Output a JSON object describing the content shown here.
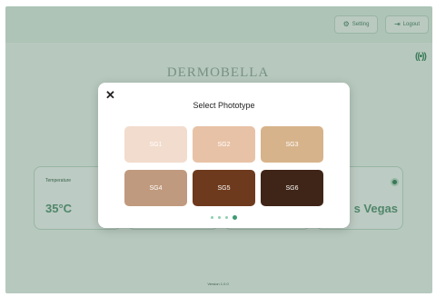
{
  "header": {
    "setting_label": "Setting",
    "logout_label": "Logout",
    "setting_icon": "gear-icon",
    "logout_icon": "logout-icon"
  },
  "status_icon": "wireless-signal-icon",
  "brand": "DERMOBELLA",
  "cards": [
    {
      "label": "Temperature",
      "value": "35°C"
    },
    {
      "label": "",
      "value": ""
    },
    {
      "label": "",
      "value": ""
    },
    {
      "label": "",
      "value": "s Vegas"
    }
  ],
  "version": "Version 1.0.0",
  "modal": {
    "title": "Select Phototype",
    "close_icon": "close-icon",
    "tiles": [
      {
        "label": "SG1",
        "color": "#f2dccd"
      },
      {
        "label": "SG2",
        "color": "#e8c2a6"
      },
      {
        "label": "SG3",
        "color": "#d7b38b"
      },
      {
        "label": "SG4",
        "color": "#c09a7e"
      },
      {
        "label": "SG5",
        "color": "#6e3a1d"
      },
      {
        "label": "SG6",
        "color": "#3f2517"
      }
    ],
    "pagination": {
      "total": 4,
      "active": 4
    }
  },
  "colors": {
    "accent": "#3e9a72",
    "background": "#dff1e6"
  }
}
